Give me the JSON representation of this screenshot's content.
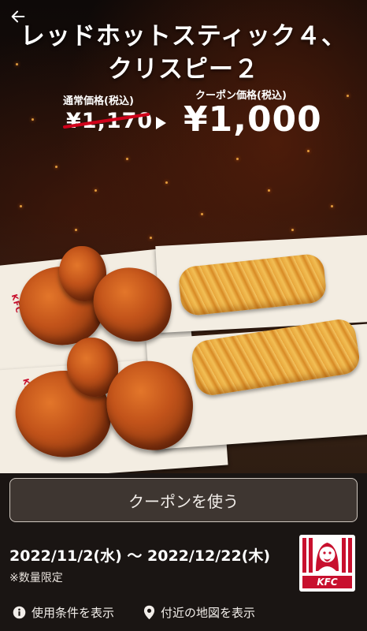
{
  "header": {
    "back_icon": "arrow-left-icon",
    "title_line1": "レッドホットスティック４、",
    "title_line2": "クリスピー２"
  },
  "pricing": {
    "regular_label": "通常価格(税込)",
    "regular_price": "¥1,170",
    "coupon_label": "クーポン価格(税込)",
    "coupon_price": "¥1,000",
    "strike_color": "#d0021b"
  },
  "product_image": {
    "wrapper_mark": "KFC"
  },
  "actions": {
    "use_coupon_label": "クーポンを使う"
  },
  "validity": {
    "period": "2022/11/2(水) 〜 2022/12/22(木)",
    "note": "※数量限定"
  },
  "brand": {
    "logo_text": "KFC",
    "brand_color": "#c8102e"
  },
  "footer": {
    "terms_label": "使用条件を表示",
    "terms_icon": "info-icon",
    "map_label": "付近の地図を表示",
    "map_icon": "location-pin-icon"
  }
}
